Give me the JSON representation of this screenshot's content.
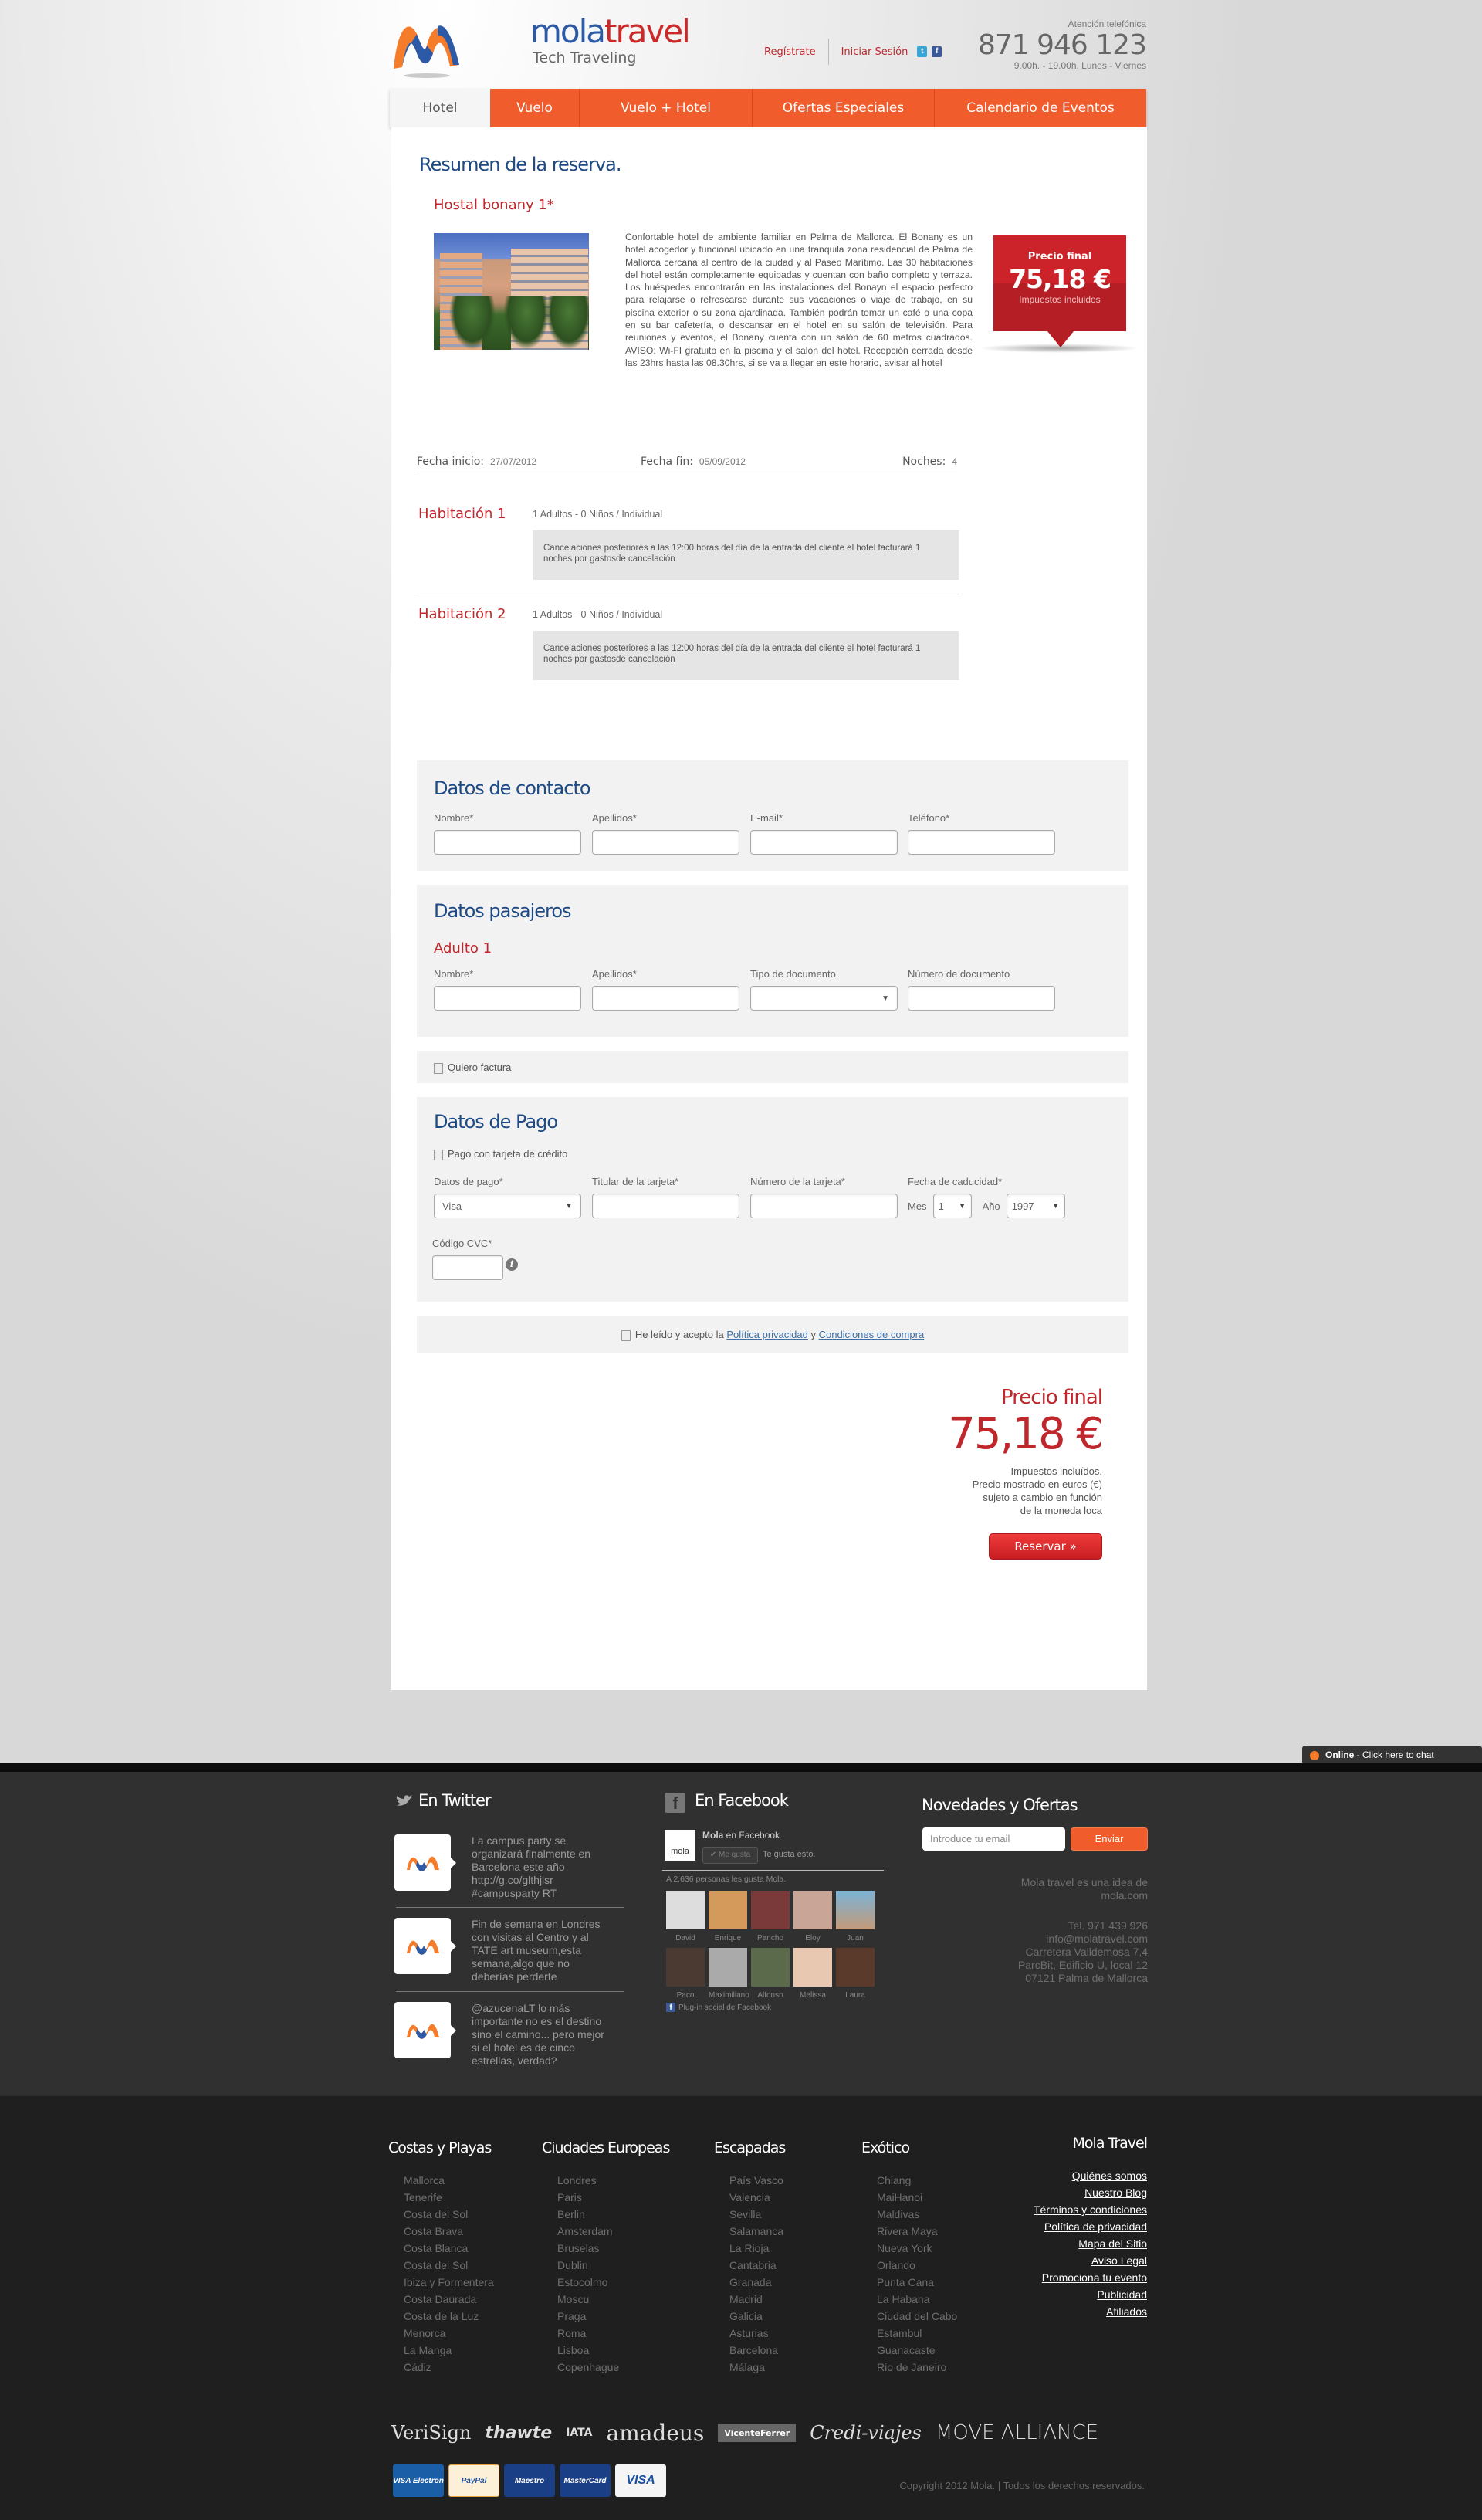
{
  "header": {
    "logo_word_1": "mola",
    "logo_word_2": "travel",
    "tagline": "Tech Traveling",
    "register": "Regístrate",
    "login": "Iniciar Sesión",
    "social": [
      {
        "name": "twitter",
        "glyph": "t",
        "color": "#38a6d8"
      },
      {
        "name": "facebook",
        "glyph": "f",
        "color": "#3b5998"
      }
    ],
    "phone_label": "Atención telefónica",
    "phone": "871 946 123",
    "hours": "9.00h. - 19.00h. Lunes - Viernes"
  },
  "nav": {
    "items": [
      "Hotel",
      "Vuelo",
      "Vuelo + Hotel",
      "Ofertas Especiales",
      "Calendario de Eventos"
    ],
    "active": "Hotel"
  },
  "summary": {
    "title": "Resumen de la reserva.",
    "hotel_name": "Hostal bonany 1*",
    "description": "Confortable hotel de ambiente familiar en Palma de Mallorca. El Bonany es un hotel acogedor y funcional ubicado en una tranquila zona residencial de Palma de Mallorca cercana al centro de la ciudad y al Paseo Marítimo. Las 30 habitaciones del hotel están completamente equipadas y cuentan con baño completo y terraza. Los huéspedes encontrarán en las instalaciones del Bonayn el espacio perfecto para relajarse o refrescarse durante sus vacaciones o viaje de trabajo, en su piscina exterior o su zona ajardinada. También podrán tomar un café o una copa en su bar cafetería, o descansar en el hotel en su salón de televisión. Para reuniones y eventos, el Bonany cuenta con un salón de 60 metros cuadrados. AVISO: Wi-FI gratuito en la piscina y el salón del hotel. Recepción cerrada desde las 23hrs hasta las 08.30hrs, si se va a llegar en este horario, avisar al hotel",
    "price_tag": {
      "label": "Precio final",
      "value": "75,18 €",
      "note": "Impuestos incluidos"
    },
    "start_label": "Fecha inicio:",
    "start": "27/07/2012",
    "end_label": "Fecha fin:",
    "end": "05/09/2012",
    "nights_label": "Noches:",
    "nights": "4",
    "rooms": [
      {
        "title": "Habitación 1",
        "details": "1 Adultos - 0 Niños / Individual",
        "cancellation": "Cancelaciones posteriores a las 12:00 horas del día de la entrada del cliente el hotel facturará 1 noches por gastosde cancelación"
      },
      {
        "title": "Habitación 2",
        "details": "1 Adultos - 0 Niños / Individual",
        "cancellation": "Cancelaciones posteriores a las 12:00 horas del día de la entrada del cliente el hotel facturará 1 noches por gastosde cancelación"
      }
    ]
  },
  "contact": {
    "title": "Datos de contacto",
    "fields": [
      {
        "label": "Nombre*",
        "value": ""
      },
      {
        "label": "Apellidos*",
        "value": ""
      },
      {
        "label": "E-mail*",
        "value": ""
      },
      {
        "label": "Teléfono*",
        "value": ""
      }
    ]
  },
  "passengers": {
    "title": "Datos pasajeros",
    "adult_title": "Adulto 1",
    "fields": [
      {
        "label": "Nombre*",
        "value": ""
      },
      {
        "label": "Apellidos*",
        "value": ""
      },
      {
        "label": "Tipo de documento",
        "value": ""
      },
      {
        "label": "Número de documento",
        "value": ""
      }
    ]
  },
  "invoice": {
    "label": "Quiero factura",
    "checked": false
  },
  "payment": {
    "title": "Datos de Pago",
    "credit_card_label": "Pago con tarjeta de crédito",
    "method_label": "Datos de pago*",
    "method_value": "Visa",
    "holder_label": "Titular de la tarjeta*",
    "number_label": "Número de la tarjeta*",
    "expiry_label": "Fecha de caducidad*",
    "month_label": "Mes",
    "month_value": "1",
    "year_label": "Año",
    "year_value": "1997",
    "cvc_label": "Código CVC*"
  },
  "terms": {
    "prefix": "He leído y acepto la ",
    "privacy": "Política privacidad",
    "and": " y ",
    "conditions": "Condiciones de compra"
  },
  "final_price": {
    "title": "Precio final",
    "value": "75,18 €",
    "notes": [
      "Impuestos incluídos.",
      "Precio mostrado en euros (€)",
      "sujeto a cambio en función",
      "de la moneda loca"
    ],
    "button": "Reservar »"
  },
  "chat": {
    "status": "Online",
    "text": " - Click here to chat"
  },
  "footer": {
    "twitter_title": "En Twitter",
    "tweets": [
      "La campus party se organizará finalmente en Barcelona este año http://g.co/glthjlsr #campusparty RT",
      "Fin de semana en Londres con visitas al Centro y al TATE art museum,esta semana,algo que no deberías perderte",
      "@azucenaLT lo más importante no es el destino sino el camino... pero mejor si el hotel es de cinco estrellas, verdad?"
    ],
    "facebook_title": "En Facebook",
    "fb_page": "Mola",
    "fb_page_suffix": " en Facebook",
    "fb_like": "✔ Me gusta",
    "fb_liked": "Te gusta esto.",
    "fb_count": "A 2,636 personas les gusta Mola.",
    "fb_friends": [
      "David",
      "Enrique",
      "Pancho",
      "Eloy",
      "Juan",
      "Paco",
      "Maximiliano",
      "Alfonso",
      "Melissa",
      "Laura"
    ],
    "fb_plugin": "Plug-in social de Facebook",
    "newsletter_title": "Novedades y Ofertas",
    "newsletter_placeholder": "Introduce tu email",
    "newsletter_button": "Enviar",
    "about": [
      "Mola travel es una idea de",
      "mola.com"
    ],
    "contact": [
      "Tel. 971 439 926",
      "info@molatravel.com",
      "Carretera Valldemosa 7,4",
      "ParcBit, Edificio U, local 12",
      "07121 Palma de Mallorca"
    ],
    "columns": [
      {
        "title": "Costas y Playas",
        "items": [
          "Mallorca",
          "Tenerife",
          "Costa del Sol",
          "Costa Brava",
          "Costa Blanca",
          "Costa del Sol",
          "Ibiza y Formentera",
          "Costa Daurada",
          "Costa de la Luz",
          "Menorca",
          "La Manga",
          "Cádiz"
        ]
      },
      {
        "title": "Ciudades Europeas",
        "items": [
          "Londres",
          "Paris",
          "Berlin",
          "Amsterdam",
          "Bruselas",
          "Dublin",
          "Estocolmo",
          "Moscu",
          "Praga",
          "Roma",
          "Lisboa",
          "Copenhague"
        ]
      },
      {
        "title": "Escapadas",
        "items": [
          "País Vasco",
          "Valencia",
          "Sevilla",
          "Salamanca",
          "La Rioja",
          "Cantabria",
          "Granada",
          "Madrid",
          "Galicia",
          "Asturias",
          "Barcelona",
          "Málaga"
        ]
      },
      {
        "title": "Exótico",
        "items": [
          "Chiang",
          "MaiHanoi",
          "Maldivas",
          "Rivera Maya",
          "Nueva York",
          "Orlando",
          "Punta Cana",
          "La Habana",
          "Ciudad del Cabo",
          "Estambul",
          "Guanacaste",
          "Rio de Janeiro"
        ]
      }
    ],
    "company_title": "Mola Travel",
    "company_links": [
      "Quiénes somos",
      "Nuestro Blog",
      "Términos y condiciones",
      "Política de privacidad",
      "Mapa del Sitio",
      "Aviso Legal",
      "Promociona tu evento",
      "Publicidad",
      "Afiliados"
    ],
    "partners": [
      "VeriSign",
      "thawte",
      "IATA",
      "amadeus",
      "VicenteFerrer",
      "Credi-viajes",
      "MOVE ALLIANCE"
    ],
    "cards": [
      {
        "name": "VISA Electron",
        "bg": "#1a5ea8",
        "fg": "#ffffff"
      },
      {
        "name": "PayPal",
        "bg": "#fdf0d8",
        "fg": "#1d4f9c"
      },
      {
        "name": "Maestro",
        "bg": "#1b3f86",
        "fg": "#ffffff"
      },
      {
        "name": "MasterCard",
        "bg": "#1b3f86",
        "fg": "#ffffff"
      },
      {
        "name": "VISA",
        "bg": "#f5f5f5",
        "fg": "#1a4fa0"
      }
    ],
    "copyright": "Copyright 2012 Mola. | Todos los derechos reservados."
  }
}
